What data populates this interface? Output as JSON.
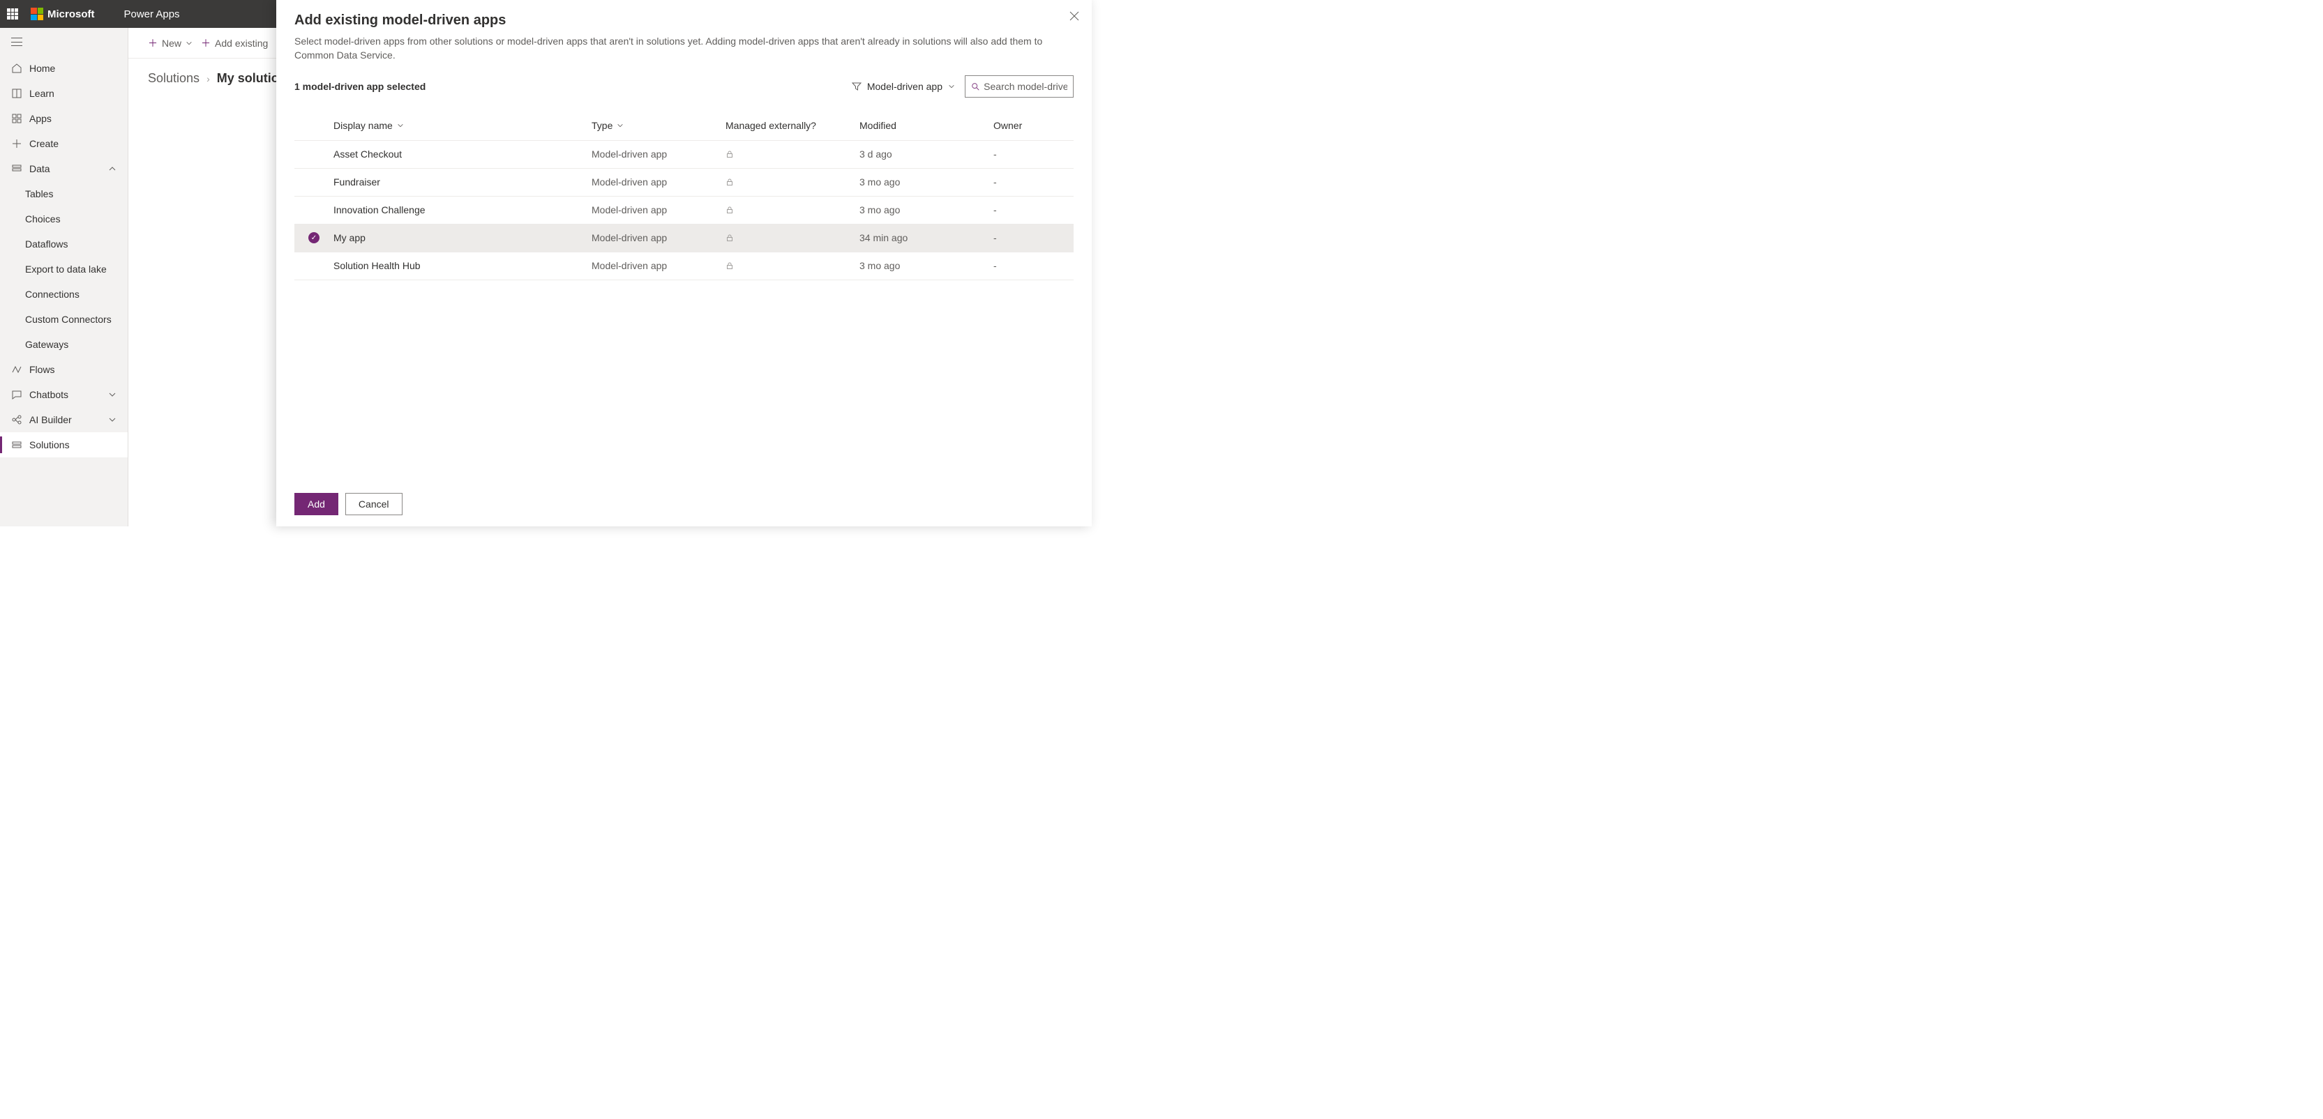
{
  "header": {
    "brand": "Microsoft",
    "app": "Power Apps"
  },
  "sidebar": {
    "items": [
      {
        "label": "Home",
        "icon": "home"
      },
      {
        "label": "Learn",
        "icon": "book"
      },
      {
        "label": "Apps",
        "icon": "grid"
      },
      {
        "label": "Create",
        "icon": "plus"
      },
      {
        "label": "Data",
        "icon": "database",
        "expanded": true,
        "children": [
          {
            "label": "Tables"
          },
          {
            "label": "Choices"
          },
          {
            "label": "Dataflows"
          },
          {
            "label": "Export to data lake"
          },
          {
            "label": "Connections"
          },
          {
            "label": "Custom Connectors"
          },
          {
            "label": "Gateways"
          }
        ]
      },
      {
        "label": "Flows",
        "icon": "flow"
      },
      {
        "label": "Chatbots",
        "icon": "chat",
        "expandable": true
      },
      {
        "label": "AI Builder",
        "icon": "ai",
        "expandable": true
      },
      {
        "label": "Solutions",
        "icon": "solutions",
        "active": true
      }
    ]
  },
  "toolbar": {
    "new_label": "New",
    "add_existing_label": "Add existing"
  },
  "breadcrumb": {
    "first": "Solutions",
    "current": "My solutio"
  },
  "panel": {
    "title": "Add existing model-driven apps",
    "description": "Select model-driven apps from other solutions or model-driven apps that aren't in solutions yet. Adding model-driven apps that aren't already in solutions will also add them to Common Data Service.",
    "selection_text": "1 model-driven app selected",
    "filter_label": "Model-driven app",
    "search_placeholder": "Search model-drive...",
    "columns": {
      "display_name": "Display name",
      "type": "Type",
      "managed": "Managed externally?",
      "modified": "Modified",
      "owner": "Owner"
    },
    "rows": [
      {
        "name": "Asset Checkout",
        "type": "Model-driven app",
        "managed": true,
        "modified": "3 d ago",
        "owner": "-",
        "selected": false
      },
      {
        "name": "Fundraiser",
        "type": "Model-driven app",
        "managed": true,
        "modified": "3 mo ago",
        "owner": "-",
        "selected": false
      },
      {
        "name": "Innovation Challenge",
        "type": "Model-driven app",
        "managed": true,
        "modified": "3 mo ago",
        "owner": "-",
        "selected": false
      },
      {
        "name": "My app",
        "type": "Model-driven app",
        "managed": true,
        "modified": "34 min ago",
        "owner": "-",
        "selected": true
      },
      {
        "name": "Solution Health Hub",
        "type": "Model-driven app",
        "managed": true,
        "modified": "3 mo ago",
        "owner": "-",
        "selected": false
      }
    ],
    "buttons": {
      "add": "Add",
      "cancel": "Cancel"
    }
  }
}
